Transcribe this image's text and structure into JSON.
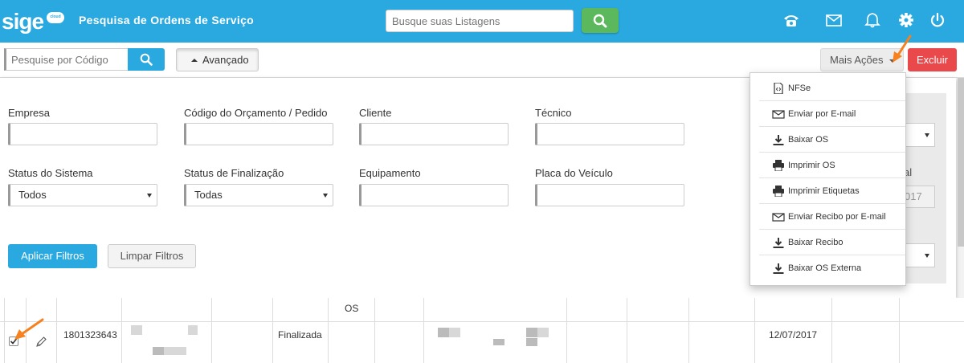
{
  "header": {
    "logo_text": "sige",
    "logo_badge": "cloud",
    "title": "Pesquisa de Ordens de Serviço",
    "search_placeholder": "Busque suas Listagens",
    "icons": [
      "phone-icon",
      "mail-icon",
      "bell-icon",
      "gear-icon",
      "power-icon"
    ]
  },
  "toolbar": {
    "code_placeholder": "Pesquise por Código",
    "advanced_label": "Avançado",
    "more_actions_label": "Mais Ações",
    "delete_label": "Excluir"
  },
  "filters": {
    "empresa_label": "Empresa",
    "codigo_label": "Código do Orçamento / Pedido",
    "cliente_label": "Cliente",
    "tecnico_label": "Técnico",
    "status_sistema_label": "Status do Sistema",
    "status_sistema_value": "Todos",
    "status_finalizacao_label": "Status de Finalização",
    "status_finalizacao_value": "Todas",
    "equipamento_label": "Equipamento",
    "placa_label": "Placa do Veículo",
    "side_label_partial": "al",
    "side_input_partial": "017",
    "apply_label": "Aplicar Filtros",
    "clear_label": "Limpar Filtros"
  },
  "more_actions_menu": [
    {
      "label": "NFSe",
      "icon": "file-code-icon"
    },
    {
      "label": "Enviar por E-mail",
      "icon": "mail-icon"
    },
    {
      "label": "Baixar OS",
      "icon": "download-icon"
    },
    {
      "label": "Imprimir OS",
      "icon": "print-icon"
    },
    {
      "label": "Imprimir Etiquetas",
      "icon": "print-icon"
    },
    {
      "label": "Enviar Recibo por E-mail",
      "icon": "mail-icon"
    },
    {
      "label": "Baixar Recibo",
      "icon": "download-icon"
    },
    {
      "label": "Baixar OS Externa",
      "icon": "download-icon"
    }
  ],
  "table": {
    "header_fragment": "OS",
    "row": {
      "code": "1801323643",
      "status": "Finalizada",
      "date": "12/07/2017",
      "checked": true
    }
  },
  "colors": {
    "header_blue": "#29a9e0",
    "green": "#5cb85c",
    "red": "#e9494a",
    "arrow_orange": "#f5821f"
  }
}
